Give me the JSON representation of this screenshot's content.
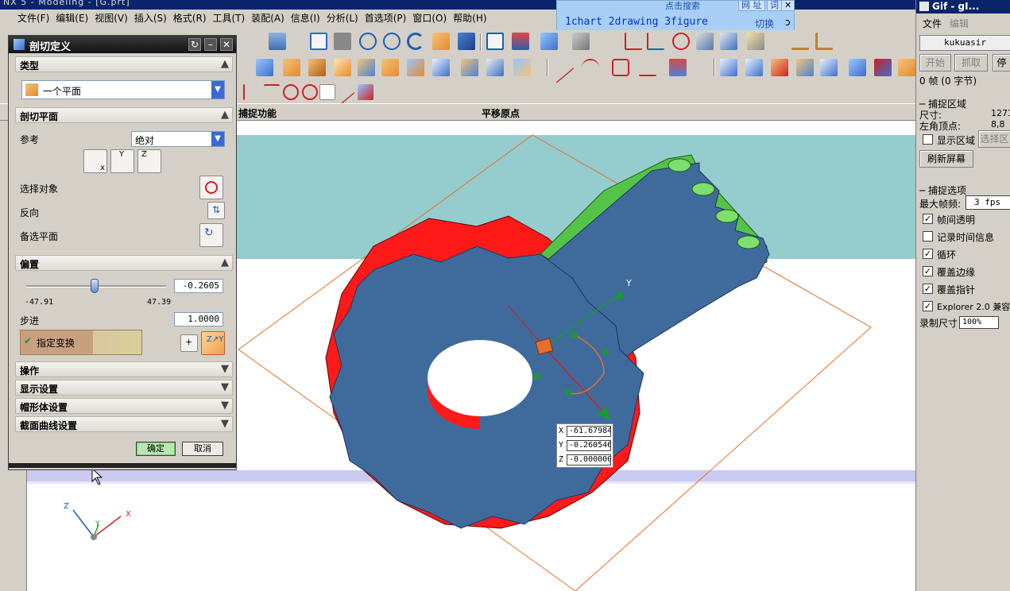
{
  "window": {
    "title": "NX 5 - Modeling - [G.prt]"
  },
  "menu": [
    "文件(F)",
    "编辑(E)",
    "视图(V)",
    "插入(S)",
    "格式(R)",
    "工具(T)",
    "装配(A)",
    "信息(I)",
    "分析(L)",
    "首选项(P)",
    "窗口(O)",
    "帮助(H)"
  ],
  "searchbar": {
    "label": "点击搜索",
    "btn1": "网 址",
    "btn2": "词",
    "close": "✕",
    "query": "1chart 2drawing 3figure",
    "switch": "切换",
    "close2": "ɔ"
  },
  "header_strip": {
    "col1": "捕捉功能",
    "col2": "平移原点"
  },
  "dialog": {
    "title": "剖切定义",
    "sections": {
      "type": "类型",
      "clip_plane": "剖切平面",
      "offset": "偏置",
      "ops": "操作",
      "display": "显示设置",
      "cap": "帽形体设置",
      "curve": "截面曲线设置"
    },
    "type_value": "一个平面",
    "ref_label": "参考",
    "ref_value": "绝对",
    "select_obj": "选择对象",
    "reverse": "反向",
    "alt_plane": "备选平面",
    "slider": {
      "min": "-47.91",
      "max": "47.39",
      "value": "-0.2605",
      "fraction": 0.49
    },
    "step_label": "步进",
    "step_value": "1.0000",
    "transform": "指定变换",
    "ok": "确定",
    "cancel": "取消"
  },
  "coords": {
    "x_label": "X",
    "x": "-61.67984",
    "y_label": "Y",
    "y": "-0.260546",
    "z_label": "Z",
    "z": "-0.000000"
  },
  "axis_labels": {
    "x": "X",
    "y": "Y",
    "z": "Z",
    "handle_y": "Y"
  },
  "gif": {
    "title": "Gif - gI...",
    "menu_file": "文件",
    "menu_edit": "编辑",
    "user": "kukuasir",
    "btn_start": "开始",
    "btn_grab": "抓取",
    "btn_stop": "停",
    "frames": "0 帧 (0 字节)",
    "region_group": "捕捉区域",
    "size_label": "尺寸:",
    "size_value": "1271",
    "corner_label": "左角顶点:",
    "corner_value": "8,8",
    "show_region": "显示区域",
    "select_btn": "选择区",
    "refresh": "刷新屏幕",
    "options_group": "捕捉选项",
    "max_fps_label": "最大帧频:",
    "max_fps": "3 fps",
    "opt1": "帧间透明",
    "opt2": "记录时间信息",
    "opt3": "循环",
    "opt4": "覆盖边缘",
    "opt5": "覆盖指针",
    "opt6": "Explorer 2.0 兼容",
    "rec_size_label": "录制尺寸",
    "rec_size": "100%"
  },
  "colors": {
    "teal": "#95cccd",
    "gear_blue": "#3f6b9c",
    "gear_red": "#ff1a1a",
    "green": "#55c24a",
    "titlebar": "#0a246a"
  }
}
